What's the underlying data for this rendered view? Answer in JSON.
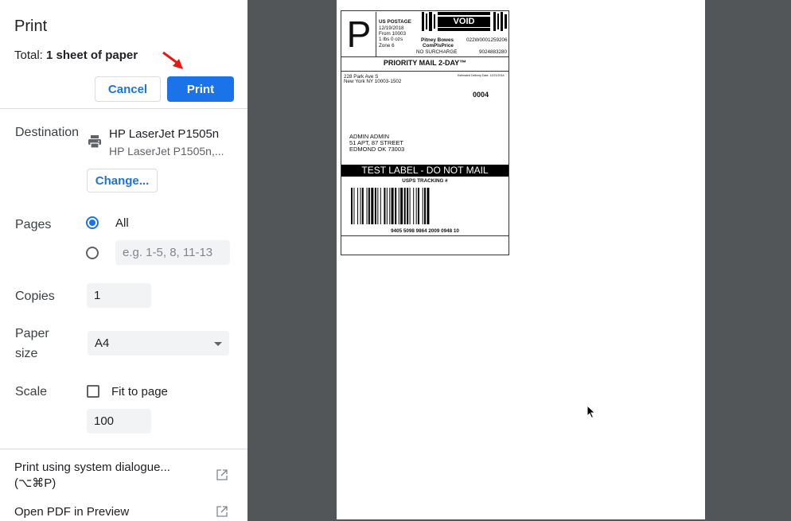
{
  "dialog": {
    "title": "Print",
    "total_label": "Total:",
    "total_value": "1 sheet of paper",
    "cancel_label": "Cancel",
    "print_label": "Print"
  },
  "destination": {
    "label": "Destination",
    "printer_name": "HP LaserJet P1505n",
    "printer_sub": "HP LaserJet P1505n,...",
    "change_label": "Change..."
  },
  "pages": {
    "label": "Pages",
    "all_label": "All",
    "custom_placeholder": "e.g. 1-5, 8, 11-13"
  },
  "copies": {
    "label": "Copies",
    "value": "1"
  },
  "paper_size": {
    "label": "Paper size",
    "value": "A4"
  },
  "scale": {
    "label": "Scale",
    "fit_label": "Fit to page",
    "value": "100"
  },
  "links": {
    "system_dialog": "Print using system dialogue... (⌥⌘P)",
    "open_pdf": "Open PDF in Preview"
  },
  "shipping_label": {
    "postage_title": "US POSTAGE",
    "date": "12/19/2018",
    "from": "From 10003",
    "weight": "1 lbs 0 ozs",
    "zone": "Zone 6",
    "void": "VOID",
    "vendor": "Pitney Bowes",
    "price_type": "ComPlsPrice",
    "meter_id": "022W0001259206",
    "surcharge": "NO SURCHARGE",
    "meter_num": "9024883280",
    "service": "PRIORITY MAIL 2-DAY™",
    "sender_line1": "228 Park Ave S",
    "sender_line2": "New York NY 10003-1502",
    "delivery_date": "Estimated Delivery Date: 12/21/2018",
    "code": "0004",
    "recipient_line1": "ADMIN ADMIN",
    "recipient_line2": "51 APT, 87 STREET",
    "recipient_line3": "EDMOND OK 73003",
    "test_banner": "TEST LABEL - DO NOT MAIL",
    "tracking_title": "USPS TRACKING #",
    "tracking_number": "9405 5098 9864 2009 0948 10"
  },
  "colors": {
    "accent": "#1a73e8",
    "preview_bg": "#525659",
    "arrow": "#e8170f"
  }
}
